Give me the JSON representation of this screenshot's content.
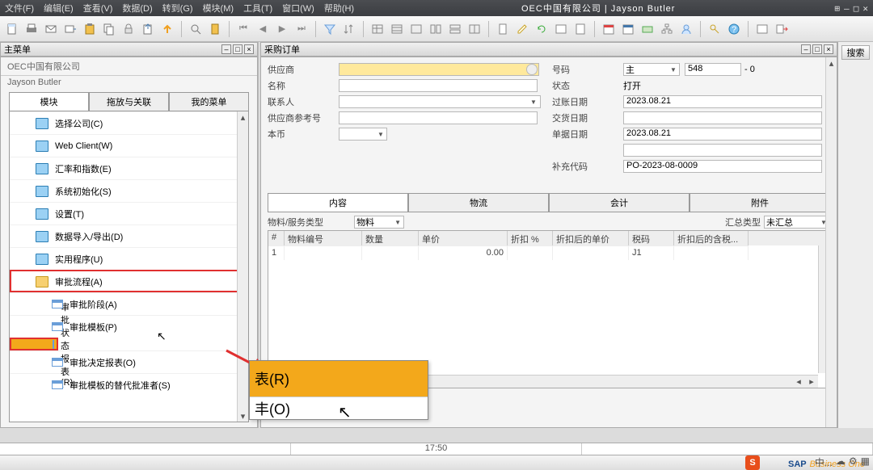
{
  "app": {
    "title": "OEC中国有限公司 | Jayson Butler"
  },
  "menubar": {
    "items": [
      "文件(F)",
      "编辑(E)",
      "查看(V)",
      "数据(D)",
      "转到(G)",
      "模块(M)",
      "工具(T)",
      "窗口(W)",
      "帮助(H)"
    ]
  },
  "leftdock": {
    "title": "主菜单",
    "company": "OEC中国有限公司",
    "user": "Jayson Butler",
    "tabs": [
      "模块",
      "拖放与关联",
      "我的菜单"
    ],
    "active_tab": 0,
    "nodes": [
      {
        "label": "选择公司(C)",
        "type": "folder"
      },
      {
        "label": "Web Client(W)",
        "type": "folder"
      },
      {
        "label": "汇率和指数(E)",
        "type": "folder"
      },
      {
        "label": "系统初始化(S)",
        "type": "folder"
      },
      {
        "label": "设置(T)",
        "type": "folder"
      },
      {
        "label": "数据导入/导出(D)",
        "type": "folder"
      },
      {
        "label": "实用程序(U)",
        "type": "folder"
      },
      {
        "label": "审批流程(A)",
        "type": "folder",
        "open": true,
        "redbox": true
      },
      {
        "label": "审批阶段(A)",
        "type": "win",
        "child": true
      },
      {
        "label": "审批模板(P)",
        "type": "win",
        "child": true
      },
      {
        "label": "审批状态报表(R)",
        "type": "win",
        "child": true,
        "redbox": true,
        "selected": true
      },
      {
        "label": "审批决定报表(O)",
        "type": "win",
        "child": true
      },
      {
        "label": "审批模板的替代批准者(S)",
        "type": "win",
        "child": true
      }
    ]
  },
  "zoom": {
    "line1": "表(R)",
    "line2": "丰(O)"
  },
  "form": {
    "title": "采购订单",
    "left_fields": [
      {
        "label": "供应商",
        "value": "",
        "yellow": true,
        "lookup": true
      },
      {
        "label": "名称",
        "value": ""
      },
      {
        "label": "联系人",
        "value": "",
        "dd": true
      },
      {
        "label": "供应商参考号",
        "value": ""
      },
      {
        "label": "本币",
        "value": "",
        "sel": true
      }
    ],
    "right_fields": [
      {
        "label": "号码",
        "sel": "主",
        "value": "548",
        "suffix": "- 0"
      },
      {
        "label": "状态",
        "plain": "打开"
      },
      {
        "label": "过账日期",
        "value": "2023.08.21"
      },
      {
        "label": "交货日期",
        "value": ""
      },
      {
        "label": "单据日期",
        "value": "2023.08.21"
      },
      {
        "label": "",
        "value": ""
      },
      {
        "label": "补充代码",
        "value": "PO-2023-08-0009"
      }
    ],
    "tabs": [
      "内容",
      "物流",
      "会计",
      "附件"
    ],
    "active_tab": 0,
    "grid_controls": {
      "left_label": "物料/服务类型",
      "left_value": "物料",
      "right_label": "汇总类型",
      "right_value": "未汇总"
    },
    "grid": {
      "columns": [
        "#",
        "物料编号",
        "数量",
        "单价",
        "折扣 %",
        "折扣后的单价",
        "税码",
        "折扣后的含税..."
      ],
      "widths": [
        20,
        96,
        70,
        110,
        56,
        94,
        56,
        92
      ],
      "rows": [
        {
          "#": "1",
          "物料编号": "",
          "数量": "",
          "单价": "0.00",
          "折扣 %": "",
          "折扣后的单价": "",
          "税码": "J1",
          "折扣后的含税...": ""
        }
      ]
    }
  },
  "search": {
    "button": "搜索"
  },
  "bottom": {
    "time": "17:50"
  },
  "brand": {
    "sap": "SAP",
    "one": "Business One",
    "cn": "中..."
  }
}
